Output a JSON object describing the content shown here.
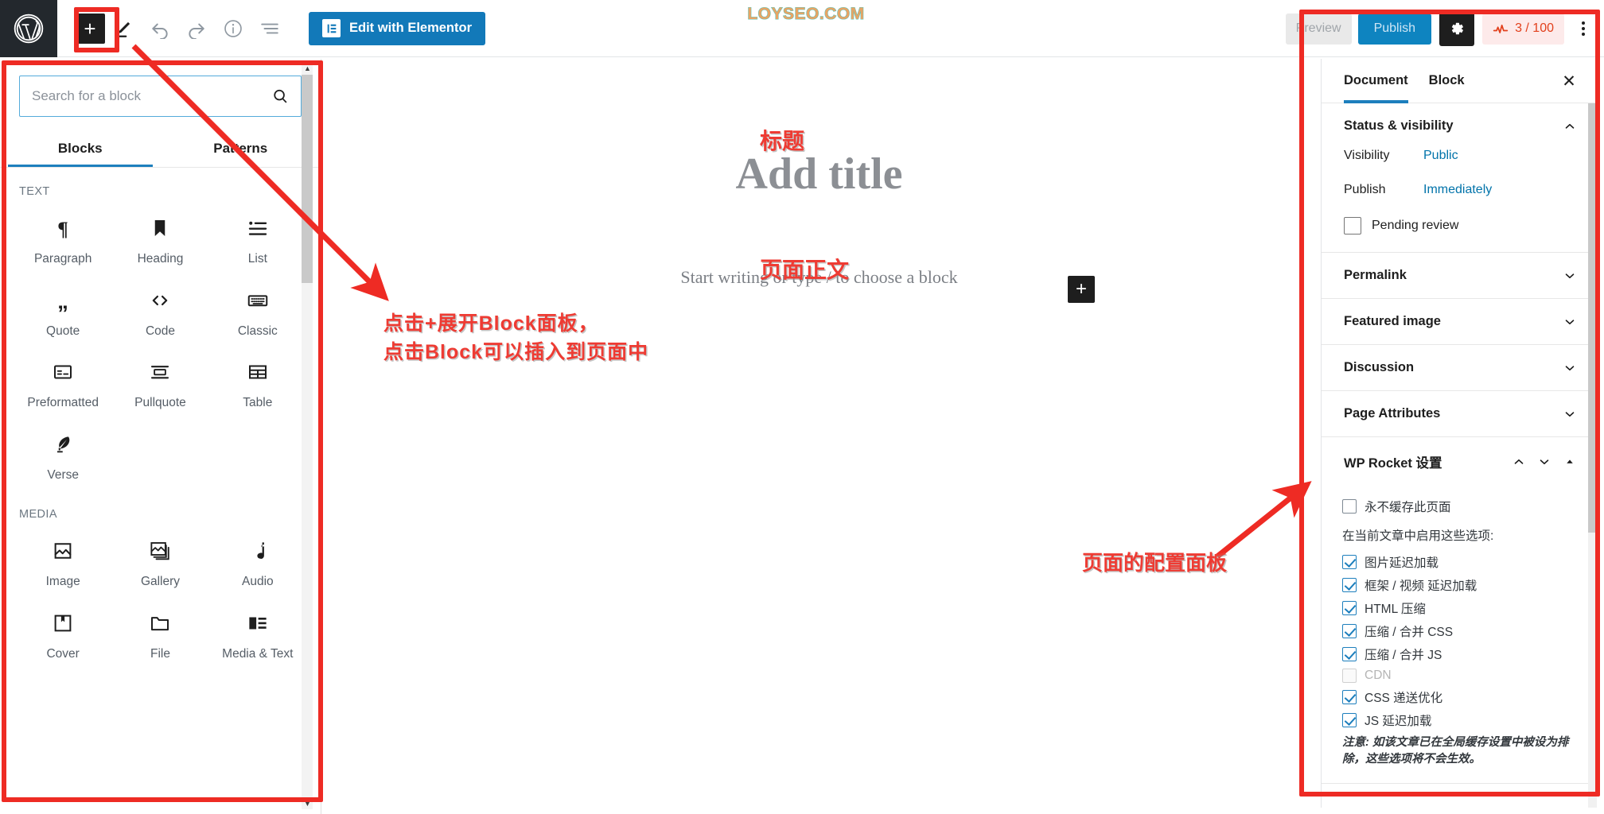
{
  "watermark": "LOYSEO.COM",
  "topbar": {
    "logo_icon": "wordpress-logo-icon",
    "inserter_label": "+",
    "icons": [
      "pen-edit-icon",
      "undo-icon",
      "redo-icon",
      "info-icon",
      "list-view-icon"
    ],
    "elementor_button": "Edit with Elementor",
    "preview_button": "Preview",
    "publish_button": "Publish",
    "settings_gear_icon": "gear-icon",
    "seo_score": "3 / 100",
    "seo_icon": "seo-meter-icon",
    "more_menu_icon": "kebab-menu-icon"
  },
  "inserter": {
    "search_placeholder": "Search for a block",
    "search_value": "",
    "search_icon": "search-icon",
    "tabs": [
      {
        "label": "Blocks",
        "active": true
      },
      {
        "label": "Patterns",
        "active": false
      }
    ],
    "categories": [
      {
        "label": "TEXT",
        "blocks": [
          {
            "label": "Paragraph",
            "icon": "paragraph-pilcrow-icon"
          },
          {
            "label": "Heading",
            "icon": "heading-bookmark-icon"
          },
          {
            "label": "List",
            "icon": "list-bullets-icon"
          },
          {
            "label": "Quote",
            "icon": "quote-marks-icon"
          },
          {
            "label": "Code",
            "icon": "code-angle-brackets-icon"
          },
          {
            "label": "Classic",
            "icon": "classic-keyboard-icon"
          },
          {
            "label": "Preformatted",
            "icon": "preformatted-box-icon"
          },
          {
            "label": "Pullquote",
            "icon": "pullquote-lines-icon"
          },
          {
            "label": "Table",
            "icon": "table-grid-icon"
          },
          {
            "label": "Verse",
            "icon": "verse-quill-icon"
          }
        ]
      },
      {
        "label": "MEDIA",
        "blocks": [
          {
            "label": "Image",
            "icon": "image-picture-icon"
          },
          {
            "label": "Gallery",
            "icon": "gallery-stack-icon"
          },
          {
            "label": "Audio",
            "icon": "audio-note-icon"
          },
          {
            "label": "Cover",
            "icon": "cover-book-icon"
          },
          {
            "label": "File",
            "icon": "file-folder-icon"
          },
          {
            "label": "Media & Text",
            "icon": "media-text-icon"
          }
        ]
      }
    ]
  },
  "canvas": {
    "title_placeholder": "Add title",
    "body_placeholder": "Start writing or type / to choose a block",
    "inserter_label": "+"
  },
  "settings": {
    "tabs": [
      {
        "label": "Document",
        "active": true
      },
      {
        "label": "Block",
        "active": false
      }
    ],
    "close_icon": "close-icon",
    "status": {
      "title": "Status & visibility",
      "collapse_icon": "chevron-up-icon",
      "visibility_label": "Visibility",
      "visibility_value": "Public",
      "publish_label": "Publish",
      "publish_value": "Immediately",
      "pending_review_label": "Pending review",
      "pending_review_checked": false
    },
    "sections": [
      {
        "title": "Permalink",
        "collapse_icon": "chevron-down-icon"
      },
      {
        "title": "Featured image",
        "collapse_icon": "chevron-down-icon"
      },
      {
        "title": "Discussion",
        "collapse_icon": "chevron-down-icon"
      },
      {
        "title": "Page Attributes",
        "collapse_icon": "chevron-down-icon"
      }
    ],
    "wp_rocket": {
      "title": "WP Rocket 设置",
      "icons": [
        "chevron-up-icon",
        "chevron-down-icon",
        "caret-up-icon"
      ],
      "never_cache_label": "永不缓存此页面",
      "never_cache_checked": false,
      "intro": "在当前文章中启用这些选项:",
      "options": [
        {
          "label": "图片延迟加载",
          "checked": true,
          "disabled": false
        },
        {
          "label": "框架 / 视频 延迟加载",
          "checked": true,
          "disabled": false
        },
        {
          "label": "HTML 压缩",
          "checked": true,
          "disabled": false
        },
        {
          "label": "压缩 / 合并 CSS",
          "checked": true,
          "disabled": false
        },
        {
          "label": "压缩 / 合并 JS",
          "checked": true,
          "disabled": false
        },
        {
          "label": "CDN",
          "checked": false,
          "disabled": true
        },
        {
          "label": "CSS 递送优化",
          "checked": true,
          "disabled": false
        },
        {
          "label": "JS 延迟加载",
          "checked": true,
          "disabled": false
        }
      ],
      "note": "注意: 如该文章已在全局缓存设置中被设为排除，这些选项将不会生效。"
    }
  },
  "annotations": {
    "title_note": "标题",
    "body_note": "页面正文",
    "block_note": "点击+展开Block面板，\n点击Block可以插入到页面中",
    "right_note": "页面的配置面板"
  },
  "colors": {
    "annotation_red": "#ee3b33",
    "accent_blue": "#1d7fbd",
    "publish_blue": "#0e84c0",
    "seo_red": "#e2401c",
    "watermark_orange": "#e8a464",
    "watermark_outline": "#5ec6bb"
  }
}
